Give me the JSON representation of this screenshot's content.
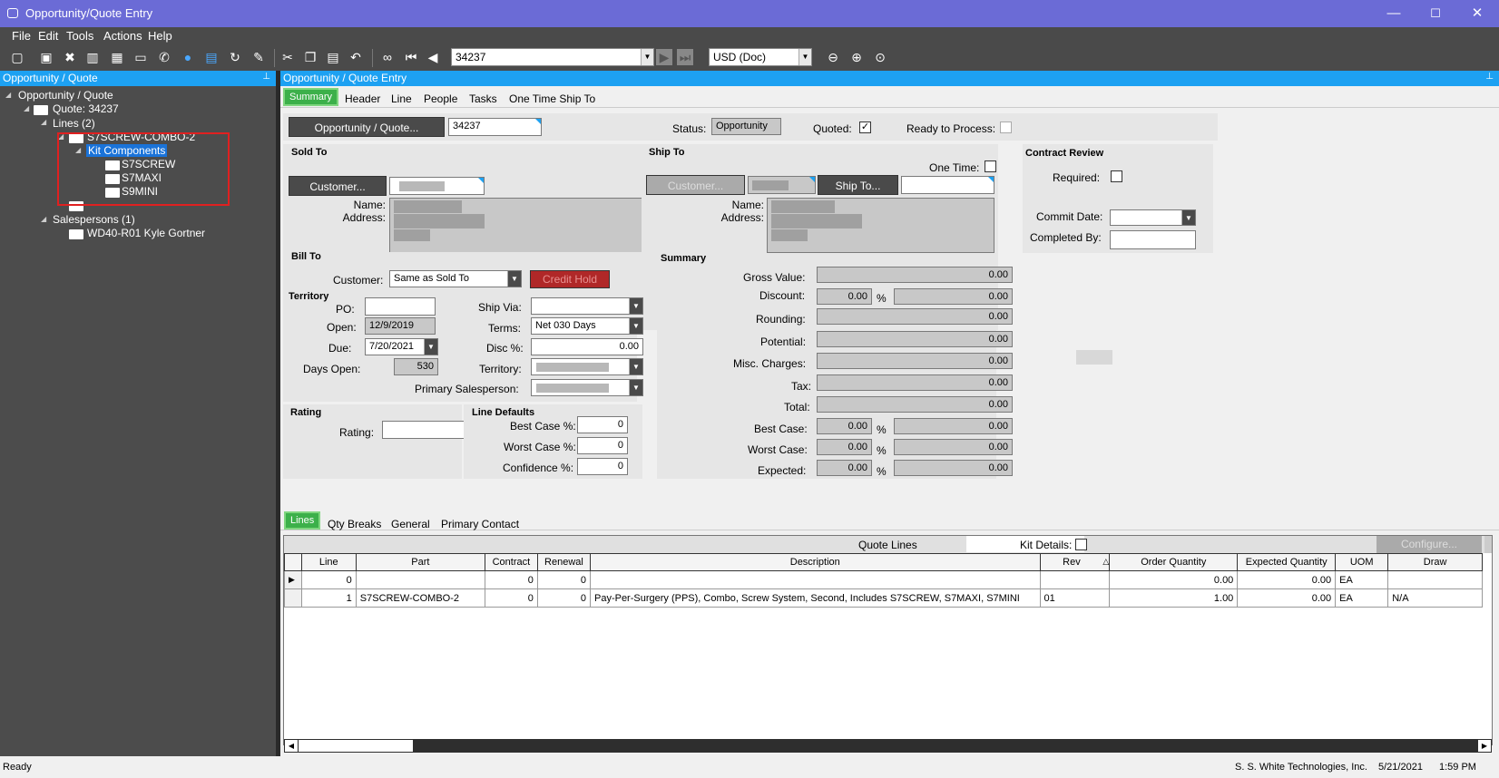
{
  "window": {
    "title": "Opportunity/Quote Entry",
    "minimize": "—",
    "maximize": "☐",
    "close": "✕"
  },
  "menu": [
    "File",
    "Edit",
    "Tools",
    "Actions",
    "Help"
  ],
  "toolbar": {
    "quote_number": "34237",
    "currency": "USD (Doc)"
  },
  "left_panel": {
    "title": "Opportunity / Quote",
    "tree": {
      "root": "Opportunity / Quote",
      "quote": "Quote: 34237",
      "lines": "Lines (2)",
      "part": "S7SCREW-COMBO-2",
      "kit": "Kit Components",
      "kit_items": [
        "S7SCREW",
        "S7MAXI",
        "S9MINI"
      ],
      "salespersons": "Salespersons (1)",
      "salesperson": "WD40-R01 Kyle Gortner"
    }
  },
  "main": {
    "title": "Opportunity / Quote Entry",
    "tabs": [
      "Summary",
      "Header",
      "Line",
      "People",
      "Tasks",
      "One Time Ship To"
    ],
    "quote_button": "Opportunity / Quote...",
    "quote_value": "34237",
    "status_label": "Status:",
    "status_value": "Opportunity",
    "quoted_label": "Quoted:",
    "quoted_check": "✓",
    "ready_label": "Ready to Process:",
    "sold_to": {
      "title": "Sold To",
      "customer_button": "Customer...",
      "name_label": "Name:",
      "address_label": "Address:"
    },
    "ship_to": {
      "title": "Ship To",
      "one_time_label": "One Time:",
      "customer_button": "Customer...",
      "shipto_button": "Ship To...",
      "name_label": "Name:",
      "address_label": "Address:"
    },
    "contract": {
      "title": "Contract Review",
      "required_label": "Required:",
      "commit_label": "Commit Date:",
      "completed_label": "Completed By:"
    },
    "bill_to": {
      "title": "Bill To",
      "customer_label": "Customer:",
      "customer_value": "Same as Sold To",
      "credit_hold": "Credit Hold"
    },
    "territory": {
      "title": "Territory",
      "po_label": "PO:",
      "open_label": "Open:",
      "open_value": "12/9/2019",
      "due_label": "Due:",
      "due_value": "7/20/2021",
      "days_open_label": "Days Open:",
      "days_open_value": "530",
      "ship_via_label": "Ship Via:",
      "terms_label": "Terms:",
      "terms_value": "Net 030 Days",
      "disc_label": "Disc %:",
      "disc_value": "0.00",
      "territory_label": "Territory:",
      "primary_sales_label": "Primary Salesperson:"
    },
    "rating": {
      "title": "Rating",
      "rating_label": "Rating:"
    },
    "line_defaults": {
      "title": "Line Defaults",
      "best_label": "Best Case %:",
      "best_value": "0",
      "worst_label": "Worst Case %:",
      "worst_value": "0",
      "conf_label": "Confidence %:",
      "conf_value": "0"
    },
    "summary": {
      "title": "Summary",
      "gross_label": "Gross Value:",
      "gross": "0.00",
      "discount_label": "Discount:",
      "discount_pct": "0.00",
      "discount": "0.00",
      "rounding_label": "Rounding:",
      "rounding": "0.00",
      "potential_label": "Potential:",
      "potential": "0.00",
      "misc_label": "Misc. Charges:",
      "misc": "0.00",
      "tax_label": "Tax:",
      "tax": "0.00",
      "total_label": "Total:",
      "total": "0.00",
      "best_label": "Best Case:",
      "best_pct": "0.00",
      "best": "0.00",
      "worst_label": "Worst Case:",
      "worst_pct": "0.00",
      "worst": "0.00",
      "expected_label": "Expected:",
      "expected_pct": "0.00",
      "expected": "0.00",
      "pct": "%"
    },
    "lower_tabs": [
      "Lines",
      "Qty Breaks",
      "General",
      "Primary Contact"
    ],
    "quote_lines": {
      "title": "Quote Lines",
      "kit_details": "Kit Details:",
      "configure": "Configure...",
      "columns": [
        "Line",
        "Part",
        "Contract",
        "Renewal",
        "Description",
        "Rev",
        "Order Quantity",
        "Expected Quantity",
        "UOM",
        "Draw"
      ],
      "rows": [
        {
          "line": "0",
          "part": "",
          "contract": "0",
          "renewal": "0",
          "description": "",
          "rev": "",
          "order_qty": "0.00",
          "expected_qty": "0.00",
          "uom": "EA",
          "draw": ""
        },
        {
          "line": "1",
          "part": "S7SCREW-COMBO-2",
          "contract": "0",
          "renewal": "0",
          "description": "Pay-Per-Surgery (PPS), Combo, Screw System, Second, Includes S7SCREW, S7MAXI, S7MINI",
          "rev": "01",
          "order_qty": "1.00",
          "expected_qty": "0.00",
          "uom": "EA",
          "draw": "N/A"
        }
      ]
    }
  },
  "status_bar": {
    "status": "Ready",
    "company": "S. S. White Technologies, Inc.",
    "date": "5/21/2021",
    "time": "1:59 PM"
  }
}
